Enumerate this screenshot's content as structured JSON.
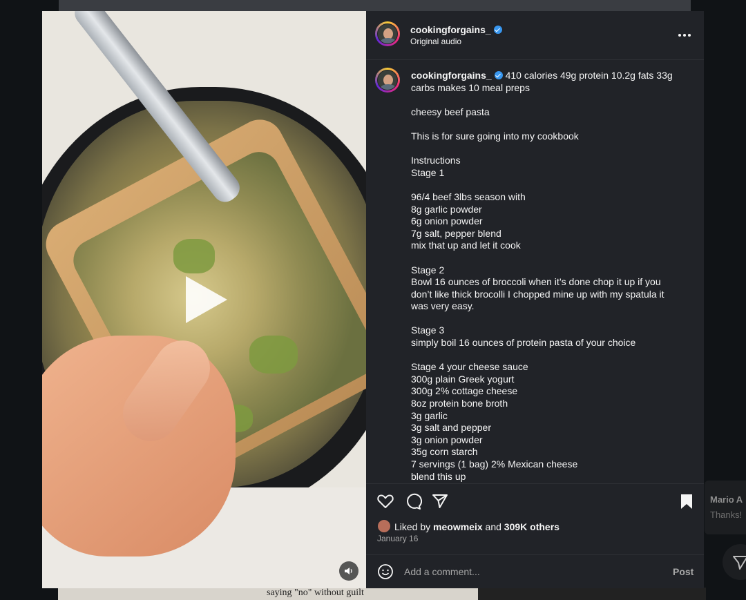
{
  "post": {
    "username": "cookingforgains_",
    "audio": "Original audio",
    "caption_lines": [
      "410 calories 49g protein 10.2g fats 33g",
      "carbs makes 10 meal preps",
      "",
      "cheesy beef pasta",
      "",
      "This is for sure going into my cookbook",
      "",
      "Instructions",
      "Stage 1",
      "",
      "96/4 beef 3lbs season with",
      "8g garlic powder",
      "6g onion powder",
      "7g salt, pepper blend",
      "mix that up and let it cook",
      "",
      "Stage 2",
      "Bowl 16 ounces of broccoli when it’s done chop it up if you",
      "don’t like thick brocolli I chopped mine up with my spatula it",
      "was very easy.",
      "",
      "Stage 3",
      "simply boil 16 ounces of protein pasta of your choice",
      "",
      "Stage 4 your cheese sauce",
      "300g plain Greek yogurt",
      "300g 2% cottage cheese",
      "8oz protein bone broth",
      "3g garlic",
      "3g salt and pepper",
      "3g onion powder",
      "35g corn starch",
      "7 servings (1 bag) 2% Mexican cheese",
      "blend this up"
    ],
    "liked_by_prefix": "Liked by ",
    "liked_by_user": "meowmeix",
    "liked_and": " and ",
    "liked_others": "309K others",
    "date": "January 16",
    "comment_placeholder": "Add a comment...",
    "post_button": "Post"
  },
  "background": {
    "bottom_text": "saying \"no\" without guilt",
    "side_name": "Mario A",
    "side_message": "Thanks!"
  },
  "icons": {
    "more": "more-icon",
    "like": "heart-icon",
    "comment": "comment-icon",
    "share": "share-icon",
    "save": "bookmark-icon",
    "emoji": "emoji-icon",
    "audio": "speaker-icon",
    "play": "play-icon"
  },
  "colors": {
    "panel": "#212328",
    "verified": "#3897f0",
    "muted": "#a8a8a8"
  }
}
